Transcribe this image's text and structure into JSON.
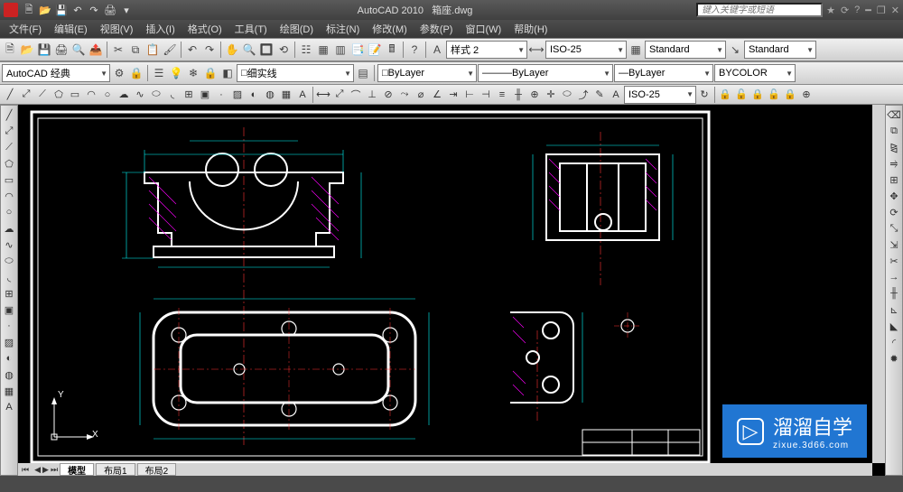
{
  "app": {
    "name": "AutoCAD 2010",
    "file": "箱座.dwg"
  },
  "search": {
    "placeholder": "键入关键字或短语"
  },
  "menu": [
    "文件(F)",
    "编辑(E)",
    "视图(V)",
    "插入(I)",
    "格式(O)",
    "工具(T)",
    "绘图(D)",
    "标注(N)",
    "修改(M)",
    "参数(P)",
    "窗口(W)",
    "帮助(H)"
  ],
  "workspace": "AutoCAD 经典",
  "linetype": "细实线",
  "layer": "ByLayer",
  "linestyle": "ByLayer",
  "lineweight": "ByLayer",
  "color": "BYCOLOR",
  "dimstyle": "ISO-25",
  "annstyle1": "样式 2",
  "annstyle2": "ISO-25",
  "textstyle": "Standard",
  "tablestyle": "Standard",
  "tabs": {
    "model": "模型",
    "layout1": "布局1",
    "layout2": "布局2"
  },
  "ucs": {
    "y": "Y",
    "x": "X"
  },
  "watermark": {
    "brand": "溜溜自学",
    "url": "zixue.3d66.com"
  }
}
